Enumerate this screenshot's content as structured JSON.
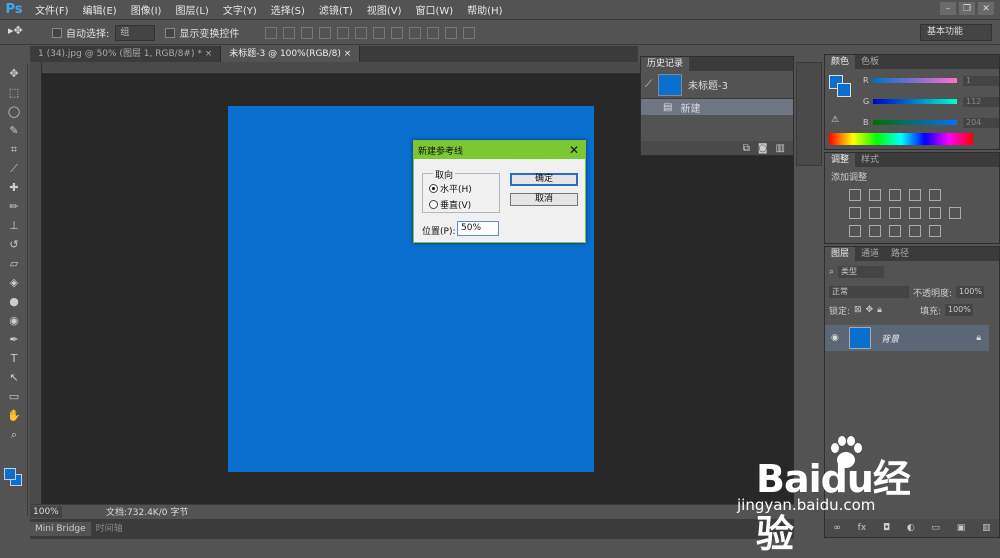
{
  "app": {
    "logo": "Ps"
  },
  "menu": [
    "文件(F)",
    "编辑(E)",
    "图像(I)",
    "图层(L)",
    "文字(Y)",
    "选择(S)",
    "滤镜(T)",
    "视图(V)",
    "窗口(W)",
    "帮助(H)"
  ],
  "window_controls": [
    "–",
    "❐",
    "✕"
  ],
  "options": {
    "auto_select_label": "自动选择:",
    "auto_select_value": "组",
    "show_transform_label": "显示变换控件",
    "workspace": "基本功能"
  },
  "tabs": [
    {
      "label": "1 (34).jpg @ 50% (图层 1, RGB/8#) *",
      "close": "×"
    },
    {
      "label": "未标题-3 @ 100%(RGB/8)",
      "close": "×"
    }
  ],
  "canvas": {
    "color": "#0a6fcf"
  },
  "status": {
    "zoom": "100%",
    "doc": "文档:732.4K/0 字节"
  },
  "bottom_tabs": [
    "Mini Bridge",
    "时间轴"
  ],
  "history": {
    "tab": "历史记录",
    "snapshot": "未标题-3",
    "step": "新建"
  },
  "color_panel": {
    "tabs": [
      "颜色",
      "色板"
    ],
    "R": {
      "label": "R",
      "value": "1"
    },
    "G": {
      "label": "G",
      "value": "112"
    },
    "B": {
      "label": "B",
      "value": "204"
    }
  },
  "adjustments": {
    "tabs": [
      "调整",
      "样式"
    ],
    "title": "添加调整"
  },
  "layers": {
    "tabs": [
      "图层",
      "通道",
      "路径"
    ],
    "filter": "类型",
    "blend_mode": "正常",
    "opacity_label": "不透明度:",
    "opacity_value": "100%",
    "lock_label": "锁定:",
    "fill_label": "填充:",
    "fill_value": "100%",
    "layer_name": "背景"
  },
  "dialog": {
    "title": "新建参考线",
    "close": "✕",
    "group_label": "取向",
    "horizontal": "水平(H)",
    "vertical": "垂直(V)",
    "selected": "horizontal",
    "ok": "确定",
    "cancel": "取消",
    "position_label": "位置(P):",
    "position_value": "50%"
  },
  "watermark": {
    "main": "Baidu经验",
    "url": "jingyan.baidu.com"
  },
  "colors": {
    "accent_green": "#7cc832",
    "canvas_blue": "#0a6fcf",
    "ps_blue": "#3fa9f5"
  }
}
